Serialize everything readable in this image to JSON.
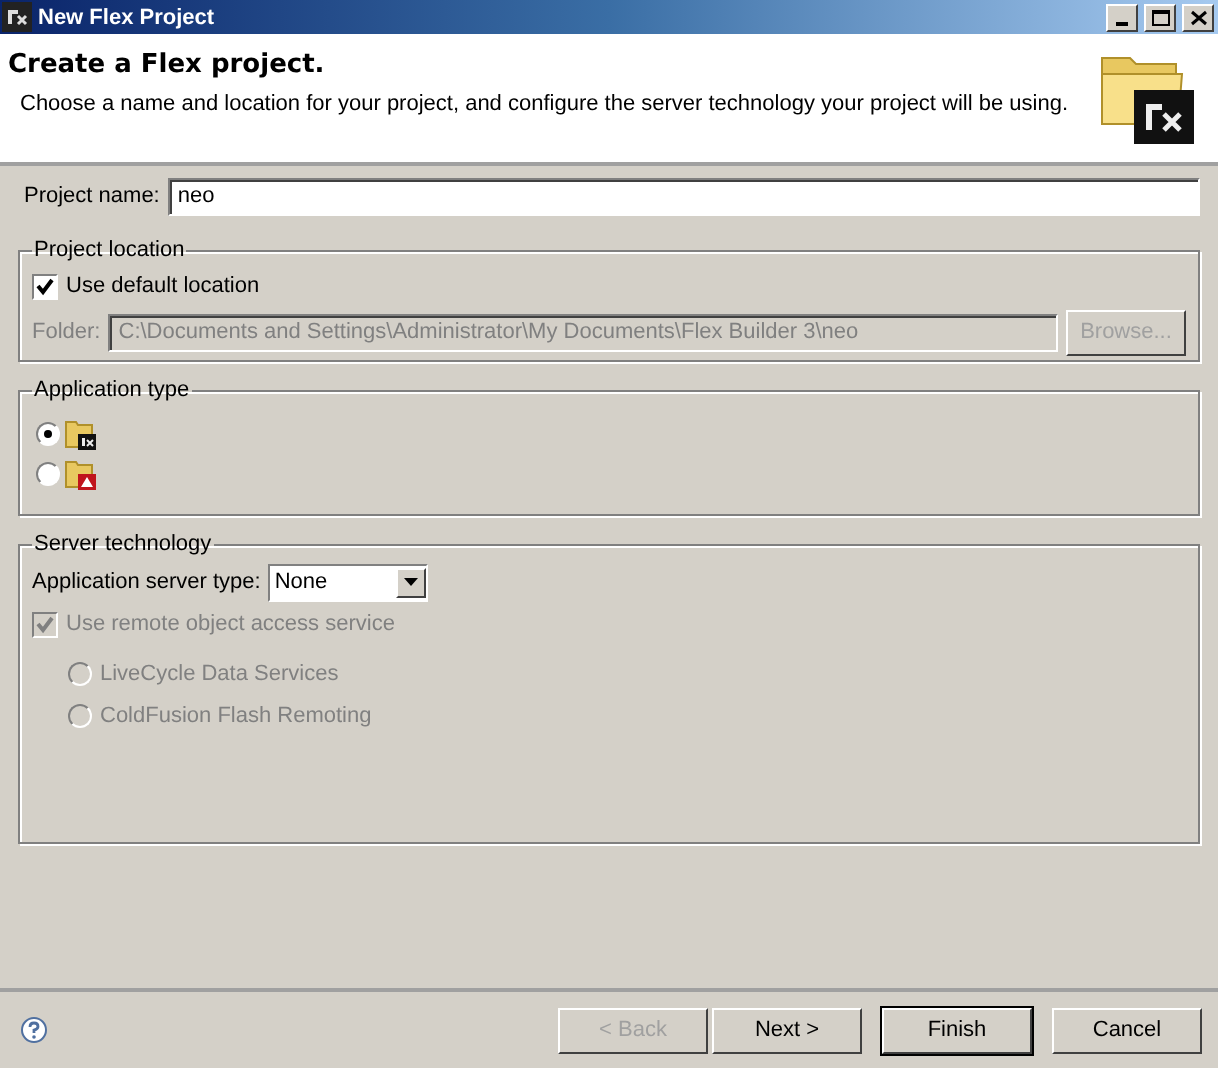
{
  "window": {
    "title": "New Flex Project"
  },
  "header": {
    "title": "Create a Flex project.",
    "description": "Choose a name and location for your project, and configure the server technology your project will be using."
  },
  "project_name": {
    "label": "Project name:",
    "value": "neo"
  },
  "project_location": {
    "title": "Project location",
    "use_default": {
      "label": "Use default location",
      "checked": true
    },
    "folder": {
      "label": "Folder:",
      "value": "C:\\Documents and Settings\\Administrator\\My Documents\\Flex Builder 3\\neo",
      "disabled": true
    },
    "browse": {
      "label": "Browse...",
      "disabled": true
    }
  },
  "application_type": {
    "title": "Application type",
    "options": [
      {
        "kind": "flex",
        "selected": true
      },
      {
        "kind": "air",
        "selected": false
      }
    ]
  },
  "server_technology": {
    "title": "Server technology",
    "server_type": {
      "label": "Application server type:",
      "value": "None"
    },
    "remote_object": {
      "label": "Use remote object access service",
      "checked": true,
      "disabled": true
    },
    "services": [
      {
        "label": "LiveCycle Data Services",
        "selected": false,
        "disabled": true
      },
      {
        "label": "ColdFusion Flash Remoting",
        "selected": false,
        "disabled": true
      }
    ]
  },
  "buttons": [
    {
      "label": "< Back",
      "disabled": true,
      "default": false
    },
    {
      "label": "Next >",
      "disabled": false,
      "default": false
    },
    {
      "label": "Finish",
      "disabled": false,
      "default": true
    },
    {
      "label": "Cancel",
      "disabled": false,
      "default": false
    }
  ]
}
